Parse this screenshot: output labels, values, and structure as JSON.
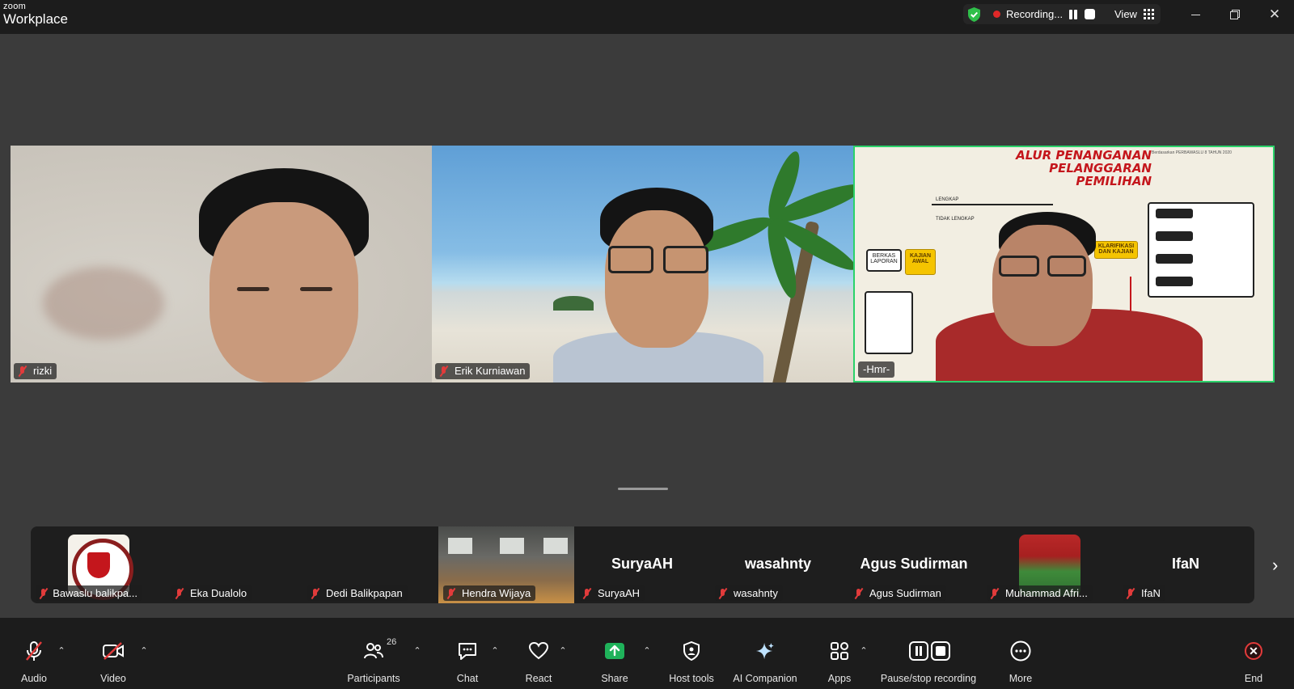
{
  "app": {
    "brand_small": "zoom",
    "brand_name": "Workplace"
  },
  "titlebar": {
    "recording_label": "Recording...",
    "view_label": "View",
    "colors": {
      "shield": "#2fbf4a",
      "record_dot": "#e02828",
      "bar": "#1c1c1c"
    }
  },
  "gallery": {
    "speakers": [
      {
        "name": "rizki",
        "muted": true
      },
      {
        "name": "Erik Kurniawan",
        "muted": true
      },
      {
        "name": "-Hmr-",
        "muted": false,
        "active_speaker": true
      }
    ],
    "active_speaker_color": "#2bd26a"
  },
  "shared_slide": {
    "title_line1": "ALUR PENANGANAN",
    "title_line2": "PELANGGARAN",
    "title_line3": "PEMILIHAN",
    "subtitle": "Berdasarkan PERBAWASLU 8 TAHUN 2020",
    "labels": [
      "LENGKAP",
      "TIDAK LENGKAP",
      "BERKAS LAPORAN",
      "KAJIAN AWAL",
      "KLARIFIKASI DAN KAJIAN"
    ]
  },
  "strip": {
    "participants": [
      {
        "name": "Bawaslu balikpa...",
        "avatar": "bawaslu-logo",
        "muted": true
      },
      {
        "name": "Eka Dualolo",
        "avatar": "none",
        "muted": true
      },
      {
        "name": "Dedi Balikpapan",
        "avatar": "none",
        "muted": true
      },
      {
        "name": "Hendra Wijaya",
        "avatar": "video",
        "muted": true
      },
      {
        "name": "SuryaAH",
        "big_name": "SuryaAH",
        "muted": true
      },
      {
        "name": "wasahnty",
        "big_name": "wasahnty",
        "muted": true
      },
      {
        "name": "Agus Sudirman",
        "big_name": "Agus Sudirman",
        "muted": true
      },
      {
        "name": "Muhammad Afri...",
        "avatar": "football-field",
        "muted": true
      },
      {
        "name": "IfaN",
        "big_name": "IfaN",
        "muted": true
      }
    ]
  },
  "toolbar": {
    "audio": "Audio",
    "video": "Video",
    "participants": "Participants",
    "participants_count": "26",
    "chat": "Chat",
    "react": "React",
    "share": "Share",
    "host_tools": "Host tools",
    "ai_companion": "AI Companion",
    "apps": "Apps",
    "pause_stop_recording": "Pause/stop recording",
    "more": "More",
    "end": "End",
    "colors": {
      "share": "#1fb25a",
      "muted": "#e23b3b",
      "end": "#e23b3b"
    }
  }
}
